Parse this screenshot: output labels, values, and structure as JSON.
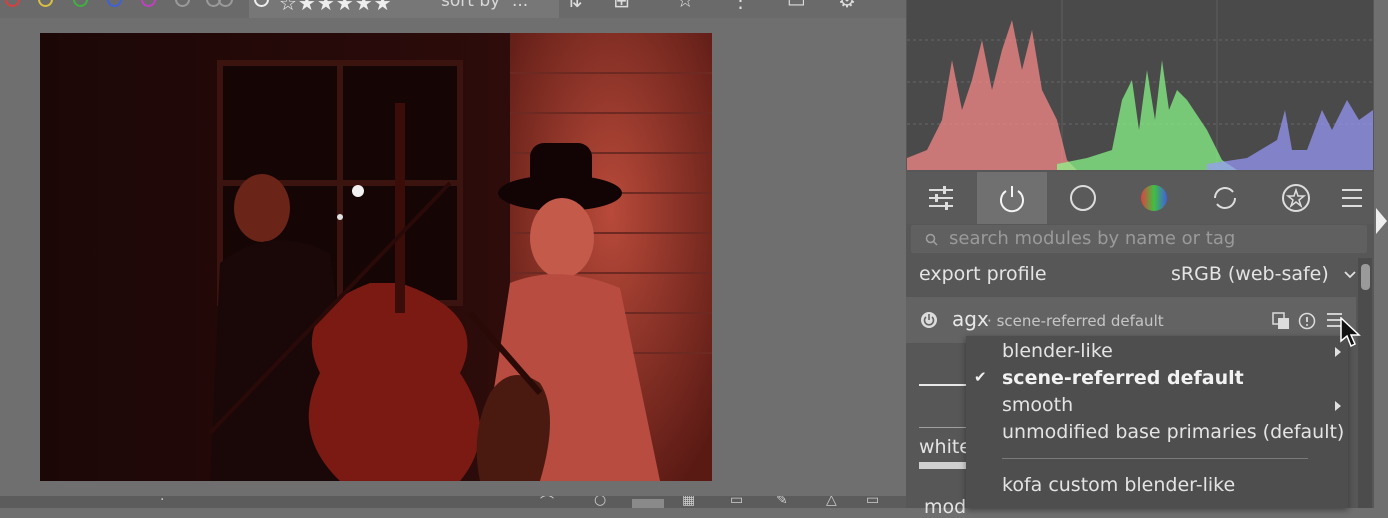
{
  "top_toolbar": {
    "color_labels": [
      "#d84040",
      "#d8c040",
      "#40b040",
      "#4060d8",
      "#c040c0"
    ],
    "stars": "☆★★★★★",
    "sort_label": "sort by",
    "sort_value": "..."
  },
  "histogram": {
    "channel_colors": [
      "#ff8a8a",
      "#8aff8a",
      "#9a9aff"
    ]
  },
  "module_tabs": {
    "items": [
      "sliders-icon",
      "power-icon",
      "circle-icon",
      "color-wheel-icon",
      "refresh-icon",
      "star-badge-icon",
      "menu-icon"
    ],
    "active_index": 1
  },
  "search": {
    "placeholder": "search modules by name or tag"
  },
  "export_profile": {
    "label": "export profile",
    "value": "sRGB (web-safe)"
  },
  "agx_module": {
    "name": "agx",
    "separator": "·",
    "preset": "scene-referred default",
    "partial_label": "white",
    "partial_bottom": "mod"
  },
  "preset_menu": {
    "items": [
      {
        "label": "blender-like",
        "checked": false,
        "submenu": true
      },
      {
        "label": "scene-referred default",
        "checked": true,
        "submenu": false
      },
      {
        "label": "smooth",
        "checked": false,
        "submenu": true
      },
      {
        "label": "unmodified base primaries (default)",
        "checked": false,
        "submenu": false
      },
      {
        "label": "kofa custom blender-like",
        "checked": false,
        "submenu": false
      }
    ],
    "checkmark": "✔"
  }
}
